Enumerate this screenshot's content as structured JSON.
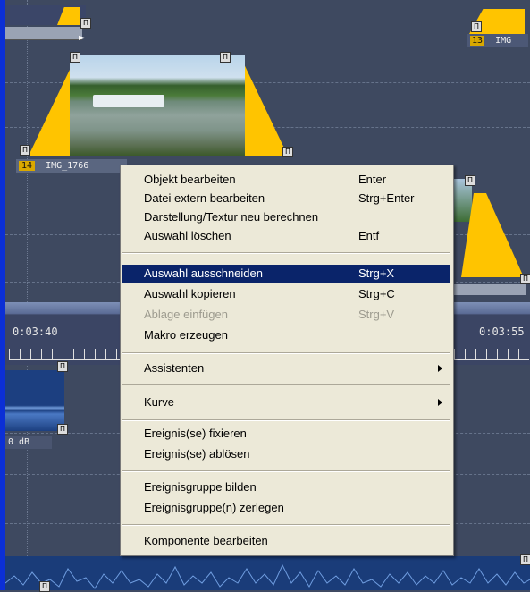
{
  "timeline": {
    "clips": [
      {
        "number": "14",
        "name": "IMG_1766"
      },
      {
        "number": "13",
        "name": "IMG"
      }
    ],
    "ruler": {
      "time_left": "0:03:40",
      "time_right": "0:03:55"
    },
    "audio": {
      "level_label": "0 dB"
    },
    "handle_glyph": "Π"
  },
  "context_menu": {
    "items": [
      {
        "label": "Objekt bearbeiten",
        "shortcut": "Enter"
      },
      {
        "label": "Datei extern bearbeiten",
        "shortcut": "Strg+Enter"
      },
      {
        "label": "Darstellung/Textur neu berechnen",
        "shortcut": ""
      },
      {
        "label": "Auswahl löschen",
        "shortcut": "Entf"
      },
      {
        "label": "Auswahl ausschneiden",
        "shortcut": "Strg+X",
        "state": "selected"
      },
      {
        "label": "Auswahl kopieren",
        "shortcut": "Strg+C"
      },
      {
        "label": "Ablage einfügen",
        "shortcut": "Strg+V",
        "state": "disabled"
      },
      {
        "label": "Makro erzeugen",
        "shortcut": ""
      },
      {
        "label": "Assistenten",
        "submenu": true
      },
      {
        "label": "Kurve",
        "submenu": true
      },
      {
        "label": "Ereignis(se) fixieren"
      },
      {
        "label": "Ereignis(se) ablösen"
      },
      {
        "label": "Ereignisgruppe bilden"
      },
      {
        "label": "Ereignisgruppe(n) zerlegen"
      },
      {
        "label": "Komponente bearbeiten"
      }
    ]
  },
  "colors": {
    "selection": "#0a246a",
    "menu_background": "#ece9d8",
    "clip_fade": "#ffc400",
    "timeline_background": "#3e4960"
  }
}
